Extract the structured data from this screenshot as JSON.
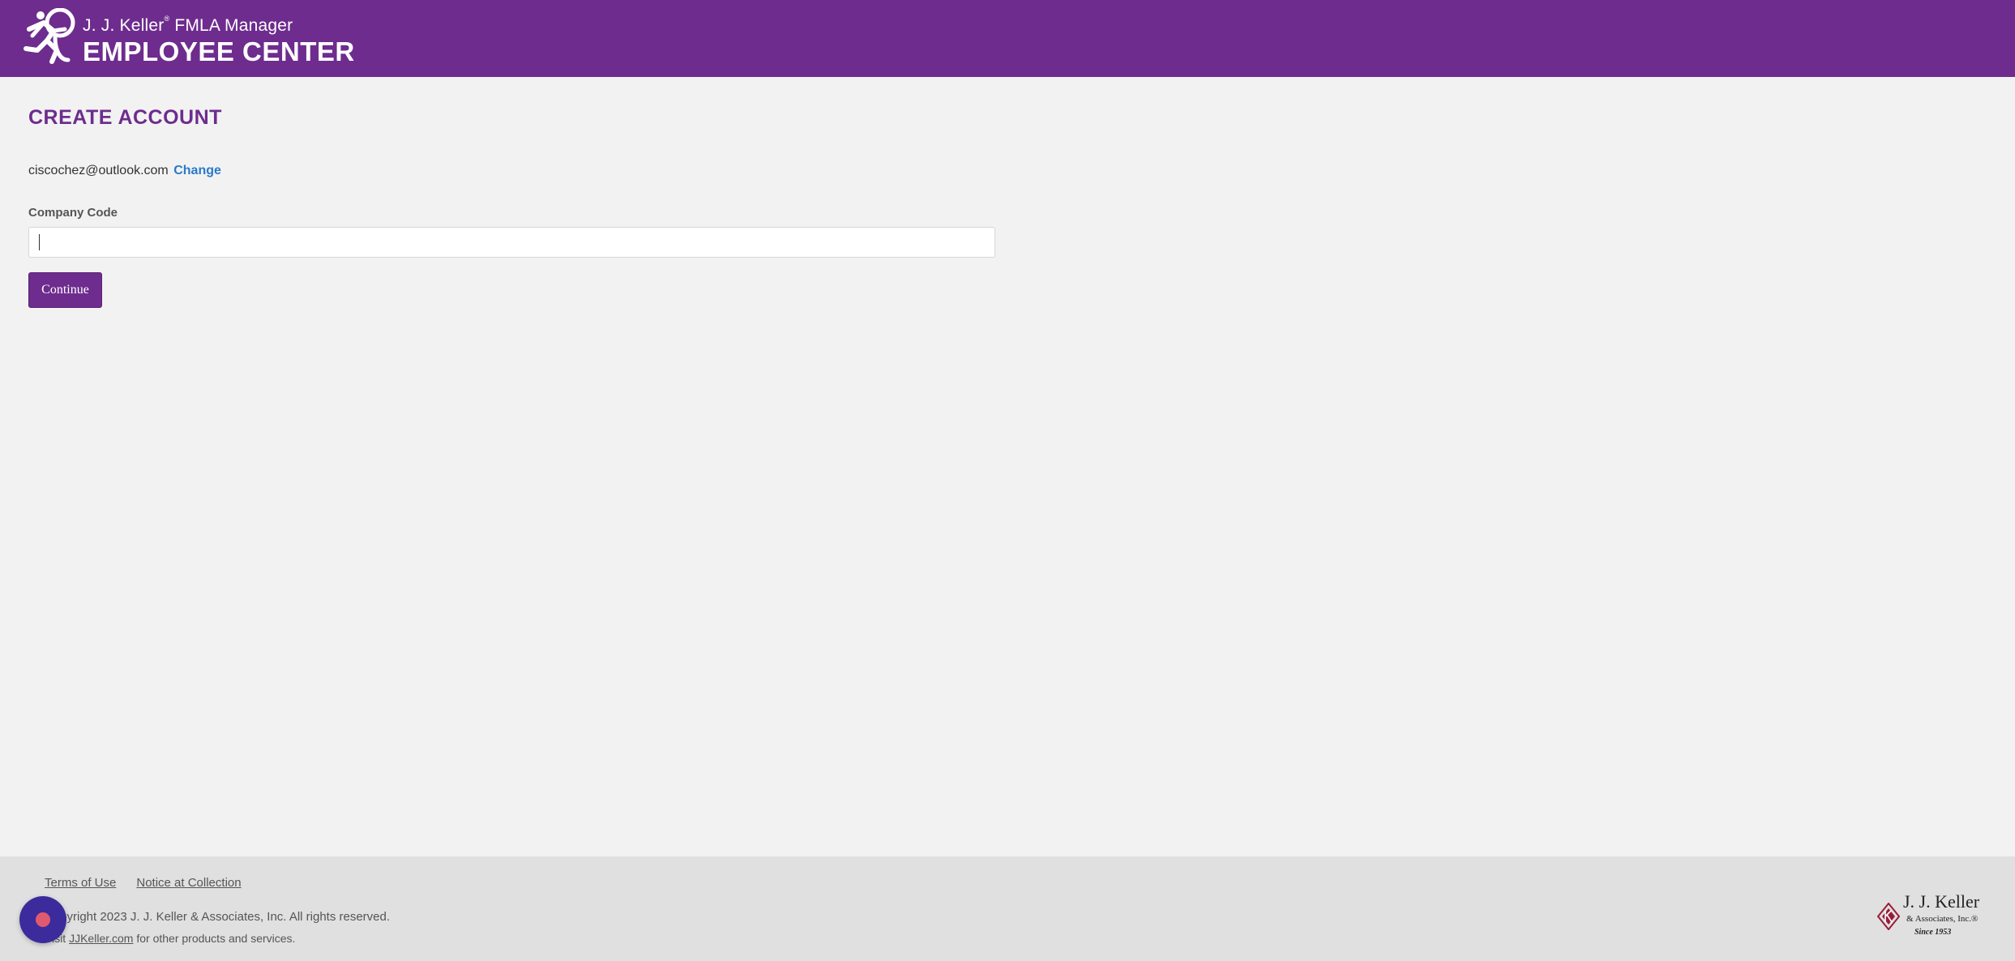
{
  "header": {
    "brand_line1": "J. J. Keller",
    "brand_registered": "®",
    "brand_product": " FMLA Manager",
    "brand_line2": "EMPLOYEE CENTER",
    "background_color": "#6e2c8e",
    "logo_icon": "running-figure-icon"
  },
  "main": {
    "title": "CREATE ACCOUNT",
    "email": "ciscochez@outlook.com",
    "change_label": "Change",
    "company_code_label": "Company Code",
    "company_code_value": "",
    "company_code_placeholder": "",
    "continue_label": "Continue",
    "accent_color": "#6e2c8e",
    "link_color": "#2a7ac9"
  },
  "footer": {
    "links": [
      {
        "label": "Terms of Use"
      },
      {
        "label": "Notice at Collection"
      }
    ],
    "copyright": "Copyright 2023 J. J. Keller & Associates, Inc. All rights reserved.",
    "visit_prefix": "Visit ",
    "visit_link": "JJKeller.com",
    "visit_suffix": " for other products and services.",
    "logo": {
      "line1": "J. J. Keller",
      "line2": "& Associates, Inc.®",
      "line3": "Since 1953"
    }
  },
  "chat_widget": {
    "icon": "chat-bubble-icon",
    "bubble_color": "#3c2b9c",
    "dot_color": "#e05a6f"
  }
}
